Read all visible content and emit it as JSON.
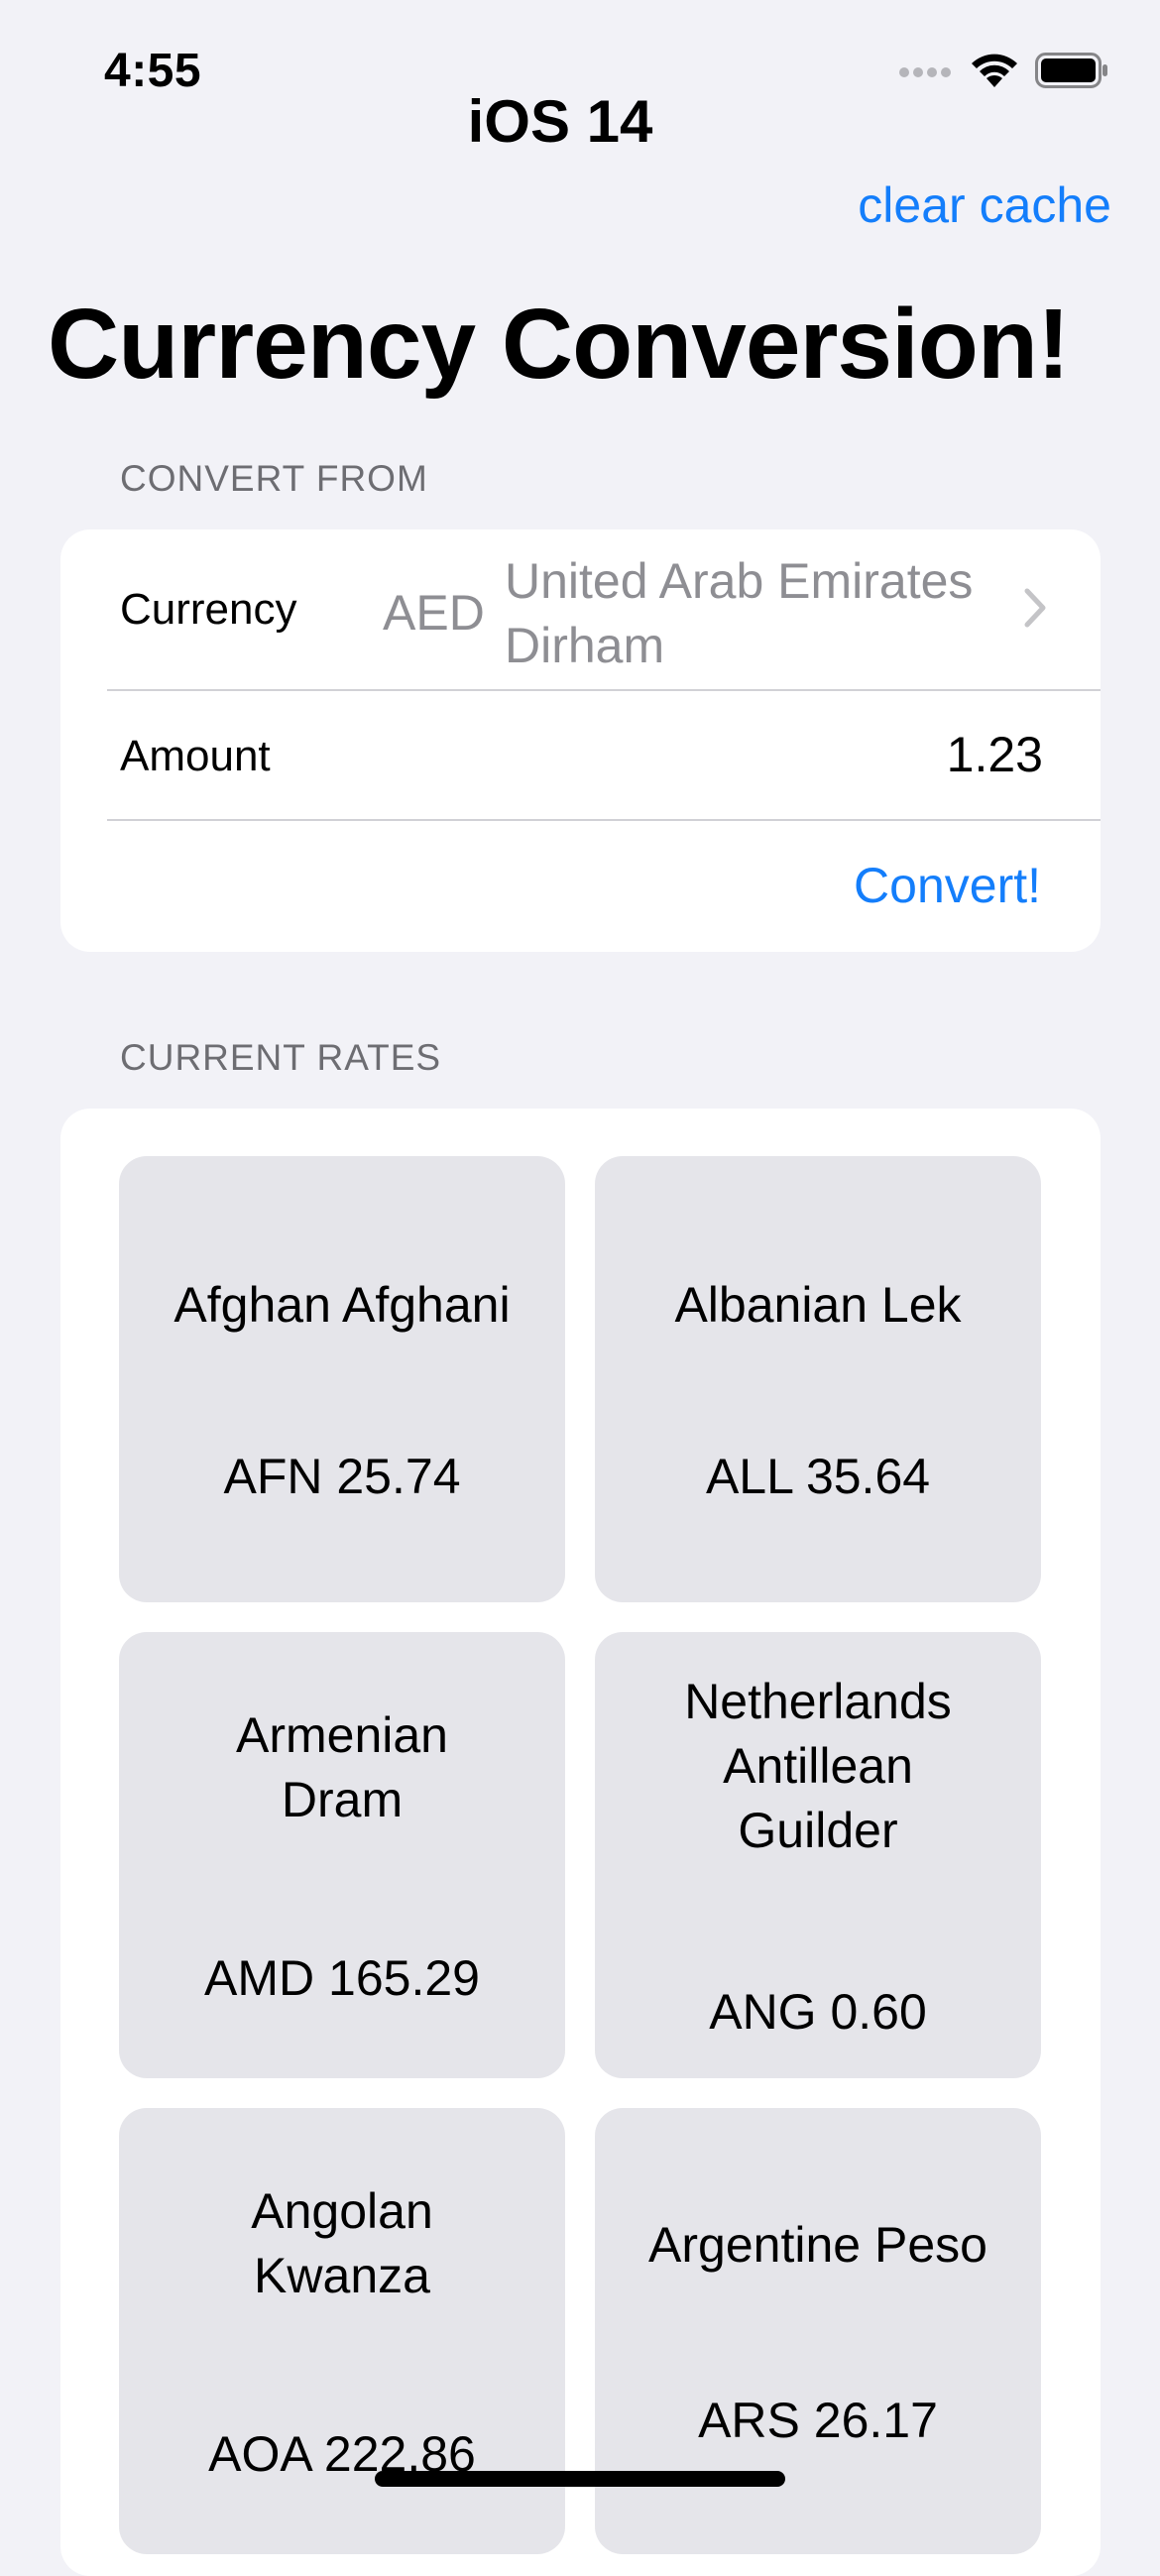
{
  "status_bar": {
    "time": "4:55"
  },
  "nav": {
    "title": "iOS 14",
    "clear_cache_label": "clear cache"
  },
  "page": {
    "title": "Currency Conversion!"
  },
  "convert_from": {
    "header": "CONVERT FROM",
    "currency_label": "Currency",
    "currency_code": "AED",
    "currency_name": "United Arab Emirates Dirham",
    "amount_label": "Amount",
    "amount_value": "1.23",
    "convert_label": "Convert!"
  },
  "current_rates": {
    "header": "CURRENT RATES",
    "tiles": [
      {
        "name": "Afghan Afghani",
        "rate": "AFN 25.74"
      },
      {
        "name": "Albanian Lek",
        "rate": "ALL 35.64"
      },
      {
        "name": "Armenian Dram",
        "rate": "AMD 165.29"
      },
      {
        "name": "Netherlands Antillean Guilder",
        "rate": "ANG 0.60"
      },
      {
        "name": "Angolan Kwanza",
        "rate": "AOA 222.86"
      },
      {
        "name": "Argentine Peso",
        "rate": "ARS 26.17"
      }
    ]
  },
  "icons": {
    "signal": "cellular-signal-icon",
    "wifi": "wifi-icon",
    "battery": "battery-icon",
    "chevron": "chevron-right-icon"
  },
  "colors": {
    "accent": "#147EFB",
    "background": "#F2F2F7",
    "card": "#FFFFFF",
    "tile": "#E5E5EA",
    "secondary_text": "#8E8E93",
    "section_header": "#6D6D72"
  }
}
